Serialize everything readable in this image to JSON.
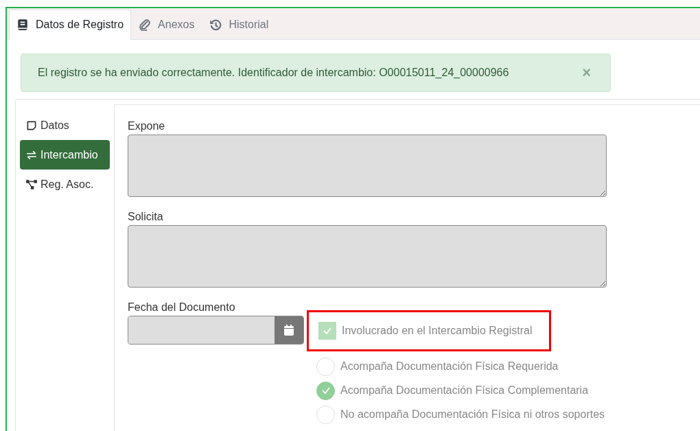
{
  "tabs": [
    {
      "label": "Datos de Registro",
      "selected": true
    },
    {
      "label": "Anexos",
      "selected": false
    },
    {
      "label": "Historial",
      "selected": false
    }
  ],
  "alert": {
    "message": "El registro se ha enviado correctamente. Identificador de intercambio: O00015011_24_00000966",
    "close": "×"
  },
  "side_nav": [
    {
      "label": "Datos",
      "selected": false
    },
    {
      "label": "Intercambio",
      "selected": true
    },
    {
      "label": "Reg. Asoc.",
      "selected": false
    }
  ],
  "fields": [
    {
      "label": "Expone"
    },
    {
      "label": "Solicita"
    }
  ],
  "date_field": {
    "label": "Fecha del Documento"
  },
  "involved": {
    "label": "Involucrado en el Intercambio Registral",
    "checked": true,
    "highlighted": true
  },
  "options": [
    {
      "label": "Acompaña Documentación Física Requerida",
      "selected": false
    },
    {
      "label": "Acompaña Documentación Física Complementaria",
      "selected": true
    },
    {
      "label": "No acompaña Documentación Física ni otros soportes",
      "selected": false
    }
  ]
}
